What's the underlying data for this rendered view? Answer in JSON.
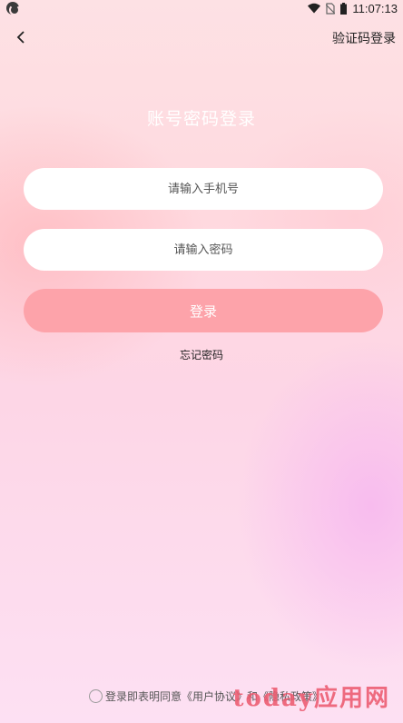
{
  "status_bar": {
    "time": "11:07:13",
    "icons": [
      "app-notification-icon",
      "wifi-icon",
      "no-sim-icon",
      "battery-icon"
    ]
  },
  "nav": {
    "back_icon": "chevron-left-icon",
    "sms_login_label": "验证码登录"
  },
  "title": "账号密码登录",
  "form": {
    "phone_placeholder": "请输入手机号",
    "phone_value": "",
    "password_placeholder": "请输入密码",
    "password_value": "",
    "login_label": "登录",
    "forgot_label": "忘记密码"
  },
  "agreement": {
    "checked": false,
    "prefix": "登录即表明同意",
    "user_agreement": "《用户协议》",
    "conjunction": "和",
    "privacy_policy": "《隐私政策》"
  },
  "watermark": "today应用网",
  "colors": {
    "login_button": "#fda3aa",
    "title_text": "#ffffff",
    "input_background": "#ffffff"
  }
}
